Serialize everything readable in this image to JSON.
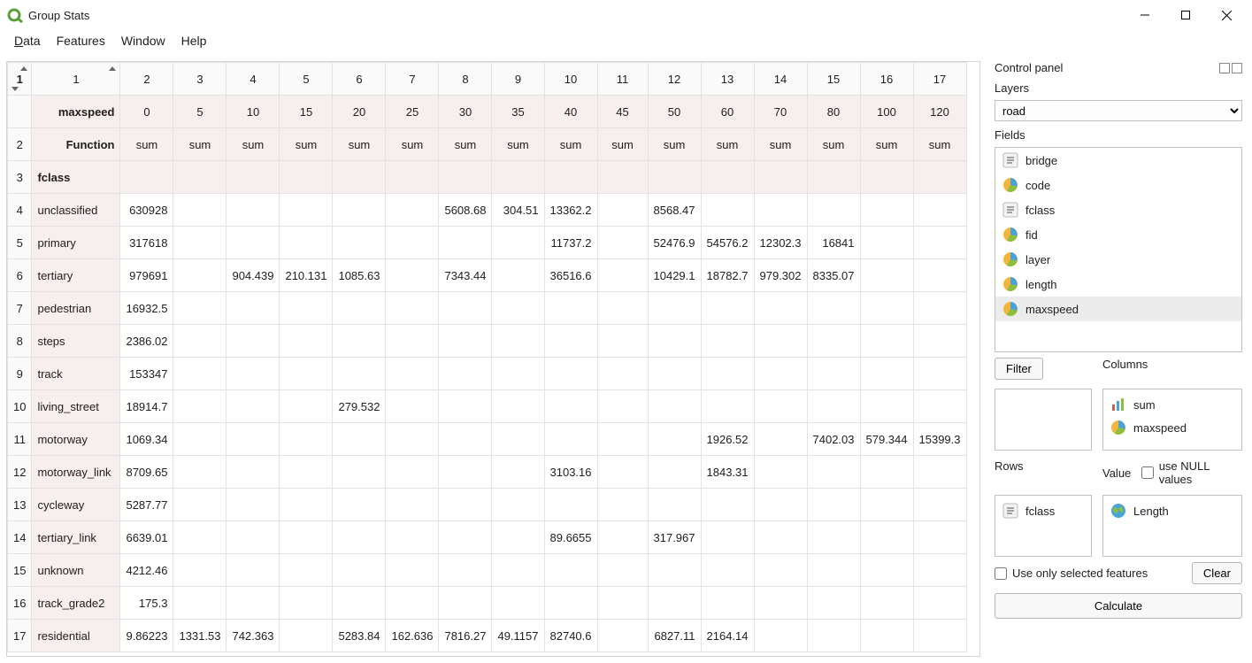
{
  "window": {
    "title": "Group Stats"
  },
  "menu": {
    "data": "Data",
    "features": "Features",
    "window": "Window",
    "help": "Help"
  },
  "table": {
    "colNumbers": [
      "1",
      "2",
      "3",
      "4",
      "5",
      "6",
      "7",
      "8",
      "9",
      "10",
      "11",
      "12",
      "13",
      "14",
      "15",
      "16",
      "17"
    ],
    "maxspeedLabel": "maxspeed",
    "maxspeedCols": [
      "0",
      "5",
      "10",
      "15",
      "20",
      "25",
      "30",
      "35",
      "40",
      "45",
      "50",
      "60",
      "70",
      "80",
      "100",
      "120"
    ],
    "functionLabel": "Function",
    "functionCols": [
      "sum",
      "sum",
      "sum",
      "sum",
      "sum",
      "sum",
      "sum",
      "sum",
      "sum",
      "sum",
      "sum",
      "sum",
      "sum",
      "sum",
      "sum",
      "sum"
    ],
    "fclassLabel": "fclass",
    "rows": [
      {
        "n": "4",
        "name": "unclassified",
        "v": [
          "630928",
          "",
          "",
          "",
          "",
          "",
          "5608.68",
          "304.51",
          "13362.2",
          "",
          "8568.47",
          "",
          "",
          "",
          "",
          ""
        ]
      },
      {
        "n": "5",
        "name": "primary",
        "v": [
          "317618",
          "",
          "",
          "",
          "",
          "",
          "",
          "",
          "11737.2",
          "",
          "52476.9",
          "54576.2",
          "12302.3",
          "16841",
          "",
          ""
        ]
      },
      {
        "n": "6",
        "name": "tertiary",
        "v": [
          "979691",
          "",
          "904.439",
          "210.131",
          "1085.63",
          "",
          "7343.44",
          "",
          "36516.6",
          "",
          "10429.1",
          "18782.7",
          "979.302",
          "8335.07",
          "",
          ""
        ]
      },
      {
        "n": "7",
        "name": "pedestrian",
        "v": [
          "16932.5",
          "",
          "",
          "",
          "",
          "",
          "",
          "",
          "",
          "",
          "",
          "",
          "",
          "",
          "",
          ""
        ]
      },
      {
        "n": "8",
        "name": "steps",
        "v": [
          "2386.02",
          "",
          "",
          "",
          "",
          "",
          "",
          "",
          "",
          "",
          "",
          "",
          "",
          "",
          "",
          ""
        ]
      },
      {
        "n": "9",
        "name": "track",
        "v": [
          "153347",
          "",
          "",
          "",
          "",
          "",
          "",
          "",
          "",
          "",
          "",
          "",
          "",
          "",
          "",
          ""
        ]
      },
      {
        "n": "10",
        "name": "living_street",
        "v": [
          "18914.7",
          "",
          "",
          "",
          "279.532",
          "",
          "",
          "",
          "",
          "",
          "",
          "",
          "",
          "",
          "",
          ""
        ]
      },
      {
        "n": "11",
        "name": "motorway",
        "v": [
          "1069.34",
          "",
          "",
          "",
          "",
          "",
          "",
          "",
          "",
          "",
          "",
          "1926.52",
          "",
          "7402.03",
          "579.344",
          "15399.3"
        ]
      },
      {
        "n": "12",
        "name": "motorway_link",
        "v": [
          "8709.65",
          "",
          "",
          "",
          "",
          "",
          "",
          "",
          "3103.16",
          "",
          "",
          "1843.31",
          "",
          "",
          "",
          ""
        ]
      },
      {
        "n": "13",
        "name": "cycleway",
        "v": [
          "5287.77",
          "",
          "",
          "",
          "",
          "",
          "",
          "",
          "",
          "",
          "",
          "",
          "",
          "",
          "",
          ""
        ]
      },
      {
        "n": "14",
        "name": "tertiary_link",
        "v": [
          "6639.01",
          "",
          "",
          "",
          "",
          "",
          "",
          "",
          "89.6655",
          "",
          "317.967",
          "",
          "",
          "",
          "",
          ""
        ]
      },
      {
        "n": "15",
        "name": "unknown",
        "v": [
          "4212.46",
          "",
          "",
          "",
          "",
          "",
          "",
          "",
          "",
          "",
          "",
          "",
          "",
          "",
          "",
          ""
        ]
      },
      {
        "n": "16",
        "name": "track_grade2",
        "v": [
          "175.3",
          "",
          "",
          "",
          "",
          "",
          "",
          "",
          "",
          "",
          "",
          "",
          "",
          "",
          "",
          ""
        ]
      },
      {
        "n": "17",
        "name": "residential",
        "v": [
          "9.86223",
          "1331.53",
          "742.363",
          "",
          "5283.84",
          "162.636",
          "7816.27",
          "49.1157",
          "82740.6",
          "",
          "6827.11",
          "2164.14",
          "",
          "",
          "",
          ""
        ]
      }
    ]
  },
  "panel": {
    "title": "Control panel",
    "layersLabel": "Layers",
    "layerSelected": "road",
    "fieldsLabel": "Fields",
    "fields": [
      {
        "name": "bridge",
        "icon": "text"
      },
      {
        "name": "code",
        "icon": "pie"
      },
      {
        "name": "fclass",
        "icon": "text"
      },
      {
        "name": "fid",
        "icon": "pie"
      },
      {
        "name": "layer",
        "icon": "pie"
      },
      {
        "name": "length",
        "icon": "pie"
      },
      {
        "name": "maxspeed",
        "icon": "pie",
        "sel": true
      }
    ],
    "filterBtn": "Filter",
    "columnsLabel": "Columns",
    "columns": [
      {
        "name": "sum",
        "icon": "bars"
      },
      {
        "name": "maxspeed",
        "icon": "pie"
      }
    ],
    "rowsLabel": "Rows",
    "rows": [
      {
        "name": "fclass",
        "icon": "text"
      }
    ],
    "valueLabel": "Value",
    "useNull": "use NULL values",
    "valueItems": [
      {
        "name": "Length",
        "icon": "globe"
      }
    ],
    "useSelected": "Use only selected features",
    "clearBtn": "Clear",
    "calcBtn": "Calculate"
  }
}
